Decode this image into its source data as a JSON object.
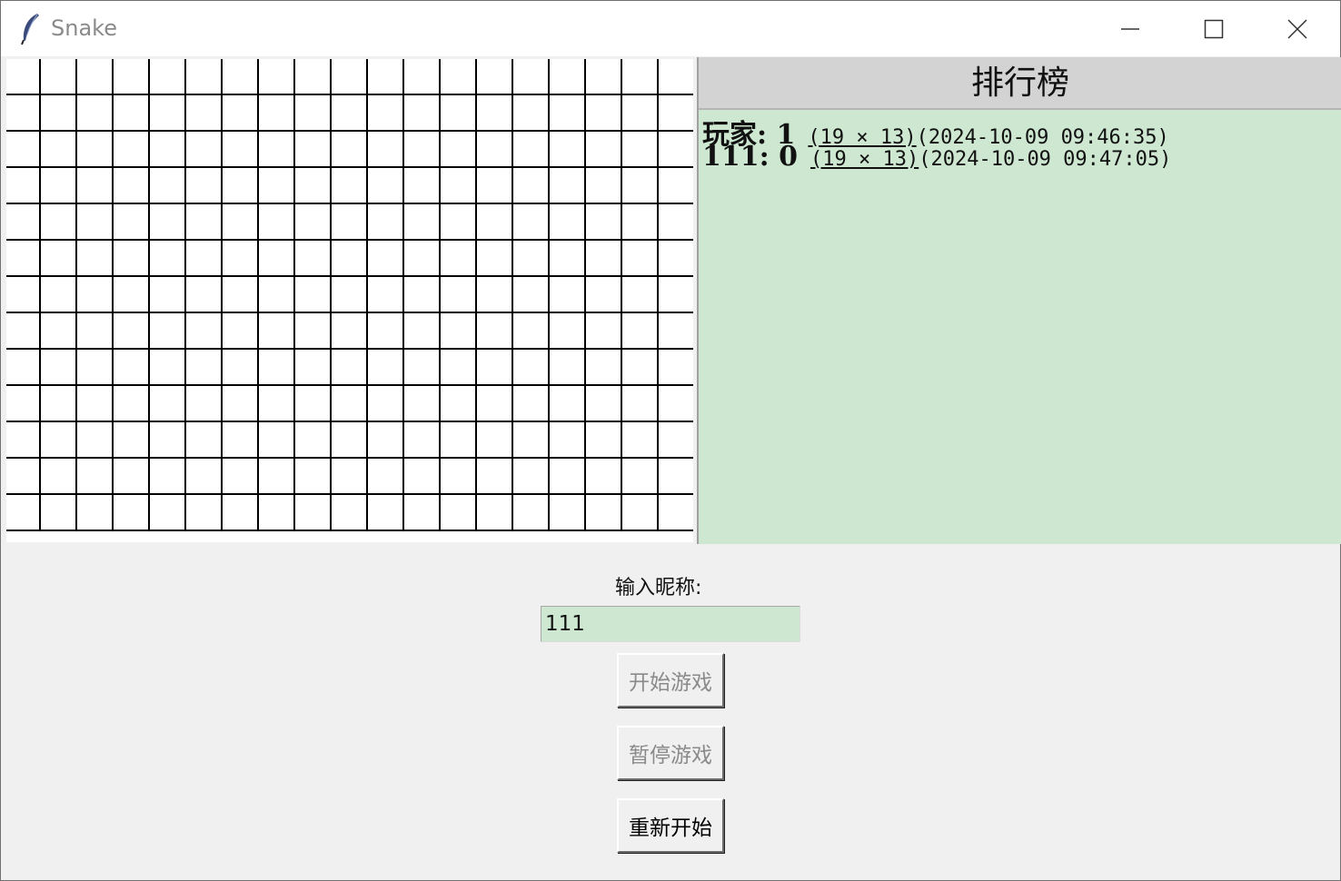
{
  "window": {
    "title": "Snake",
    "icon": "feather-icon",
    "controls": [
      "minimize-icon",
      "maximize-icon",
      "close-icon"
    ]
  },
  "board": {
    "columns": 19,
    "rows": 13,
    "background": "#ffffff",
    "line_color": "#000000"
  },
  "leaderboard": {
    "header": "排行榜",
    "background": "#cde7d0",
    "header_background": "#d3d3d3",
    "entries": [
      {
        "name_score": "玩家: 1",
        "size": "(19 × 13)",
        "time": "(2024-10-09 09:46:35)"
      },
      {
        "name_score": "111: 0",
        "size": "(19 × 13)",
        "time": "(2024-10-09 09:47:05)"
      }
    ]
  },
  "controls": {
    "nickname_label": "输入昵称:",
    "nickname_value": "111",
    "start_label": "开始游戏",
    "start_enabled": false,
    "pause_label": "暂停游戏",
    "pause_enabled": false,
    "restart_label": "重新开始",
    "restart_enabled": true
  }
}
